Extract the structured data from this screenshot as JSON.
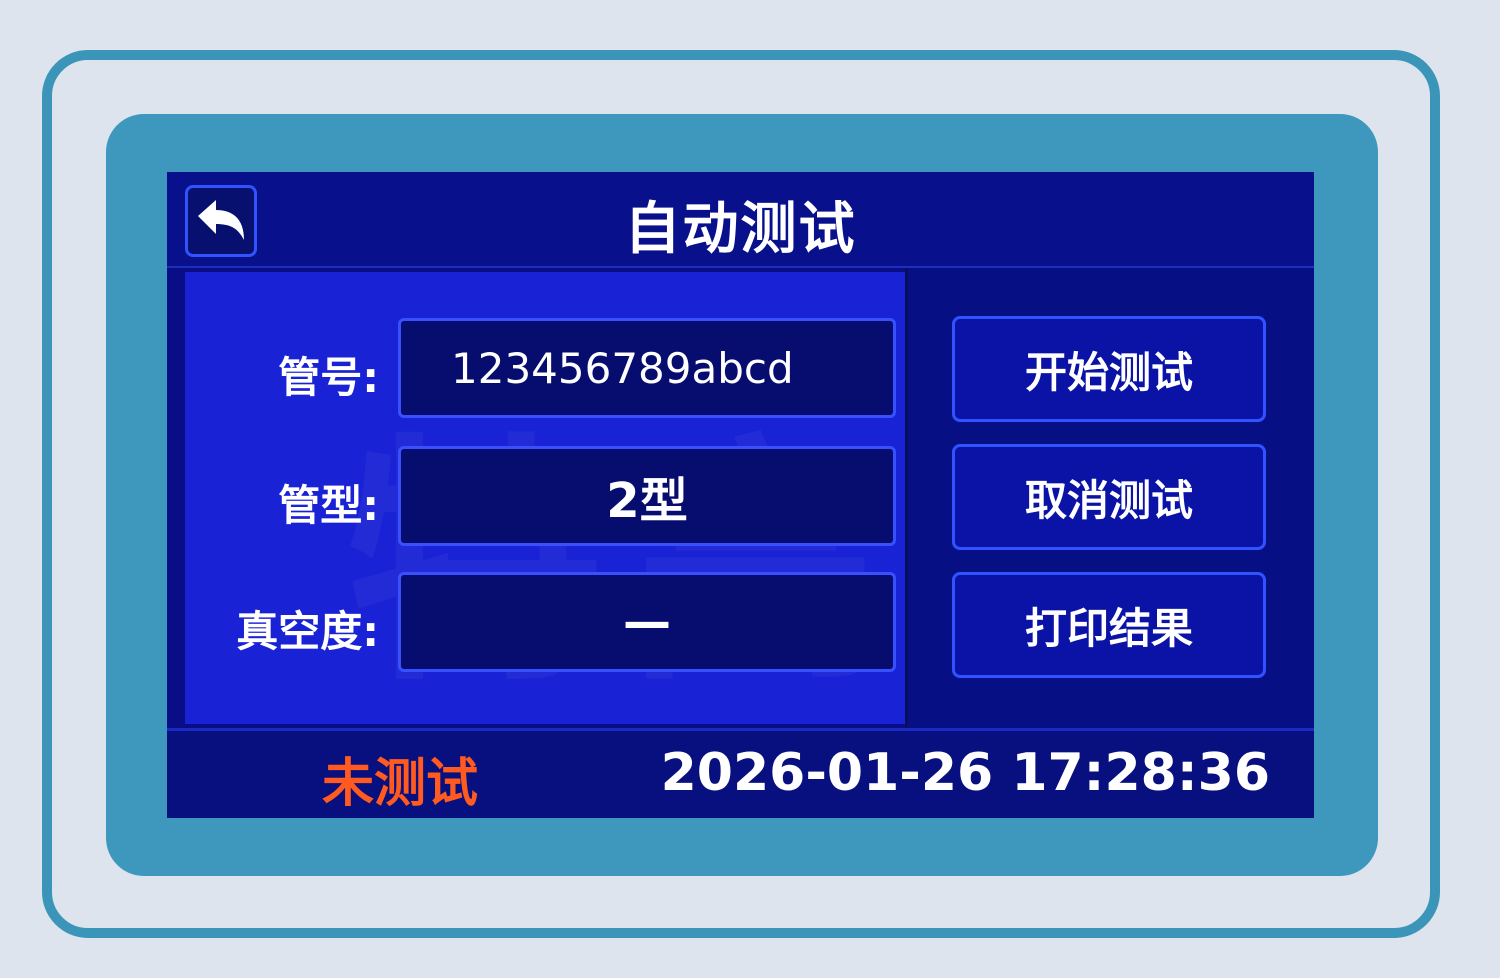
{
  "header": {
    "title": "自动测试",
    "back_icon": "back-arrow-icon"
  },
  "form": {
    "tube_number": {
      "label": "管号:",
      "value": "123456789abcd"
    },
    "tube_type": {
      "label": "管型:",
      "value": "2型"
    },
    "vacuum": {
      "label": "真空度:",
      "value": "—"
    }
  },
  "actions": {
    "start_label": "开始测试",
    "cancel_label": "取消测试",
    "print_label": "打印结果"
  },
  "status": {
    "text": "未测试",
    "datetime": "2026-01-26 17:28:36",
    "color": "#ff5a1f"
  },
  "watermark": "特高压",
  "colors": {
    "screen_bg": "#0a0e86",
    "panel_bg": "#1a22d6",
    "accent_border": "#3152ff",
    "bezel": "#3e98be"
  }
}
